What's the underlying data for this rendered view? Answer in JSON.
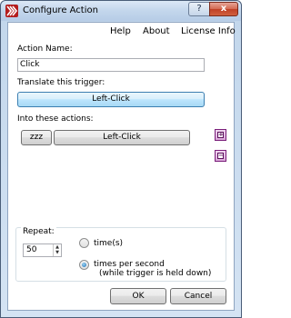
{
  "window": {
    "title": "Configure Action",
    "help_glyph": "?",
    "close_glyph": "x"
  },
  "menu": {
    "items": [
      "Help",
      "About",
      "License Info"
    ]
  },
  "form": {
    "action_name_label": "Action Name:",
    "action_name_value": "Click",
    "translate_label": "Translate this trigger:",
    "trigger_button": "Left-Click",
    "into_actions_label": "Into these actions:",
    "actions": [
      {
        "delay": "zzz",
        "action": "Left-Click"
      }
    ],
    "add_glyph": "+",
    "remove_glyph": "−"
  },
  "repeat": {
    "label": "Repeat:",
    "count": "50",
    "options": [
      {
        "label": "time(s)",
        "selected": false
      },
      {
        "label": "times per second",
        "sublabel": "(while trigger is held down)",
        "selected": true
      }
    ]
  },
  "footer": {
    "ok_label": "OK",
    "cancel_label": "Cancel"
  },
  "colors": {
    "accent": "#3c7fb1",
    "list_button": "#d9a6d9",
    "close_button": "#c04026"
  }
}
